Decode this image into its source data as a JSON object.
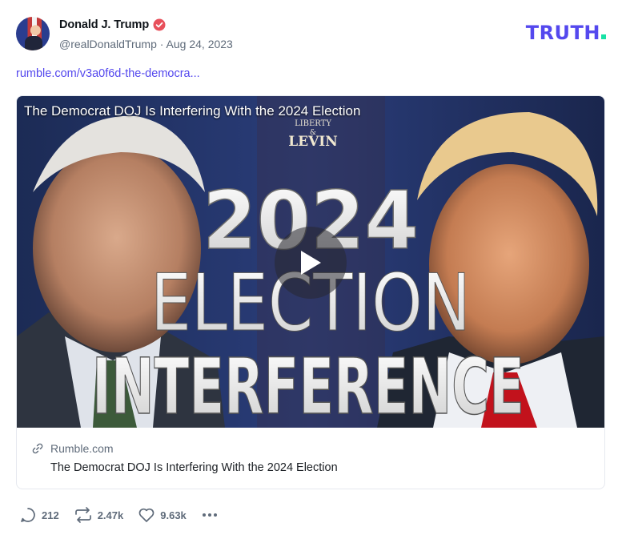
{
  "post": {
    "author_name": "Donald J. Trump",
    "handle": "@realDonaldTrump",
    "separator": "·",
    "date": "Aug 24, 2023",
    "link_text": "rumble.com/v3a0f6d-the-democra..."
  },
  "brand": {
    "logo_text": "TRUTH",
    "color": "#5448ee",
    "dot_color": "#17e2a5"
  },
  "icons": {
    "verified": "verified-badge-icon",
    "link": "link-icon",
    "reply": "reply-icon",
    "retruth": "retruth-icon",
    "like": "heart-icon",
    "more": "more-icon",
    "play": "play-icon"
  },
  "link_card": {
    "video_overlay_title": "The Democrat DOJ Is Interfering With the 2024 Election",
    "thumbnail_badge_top": "LIBERTY",
    "thumbnail_badge_mid": "&",
    "thumbnail_badge_name": "LEVIN",
    "thumbnail_line1": "2024",
    "thumbnail_line2": "ELECTION",
    "thumbnail_line3": "INTERFERENCE",
    "domain": "Rumble.com",
    "title": "The Democrat DOJ Is Interfering With the 2024 Election"
  },
  "stats": {
    "replies": "212",
    "retruths": "2.47k",
    "likes": "9.63k"
  },
  "colors": {
    "accent": "#5448ee",
    "verified": "#e8505b",
    "muted": "#5f6b7a"
  }
}
